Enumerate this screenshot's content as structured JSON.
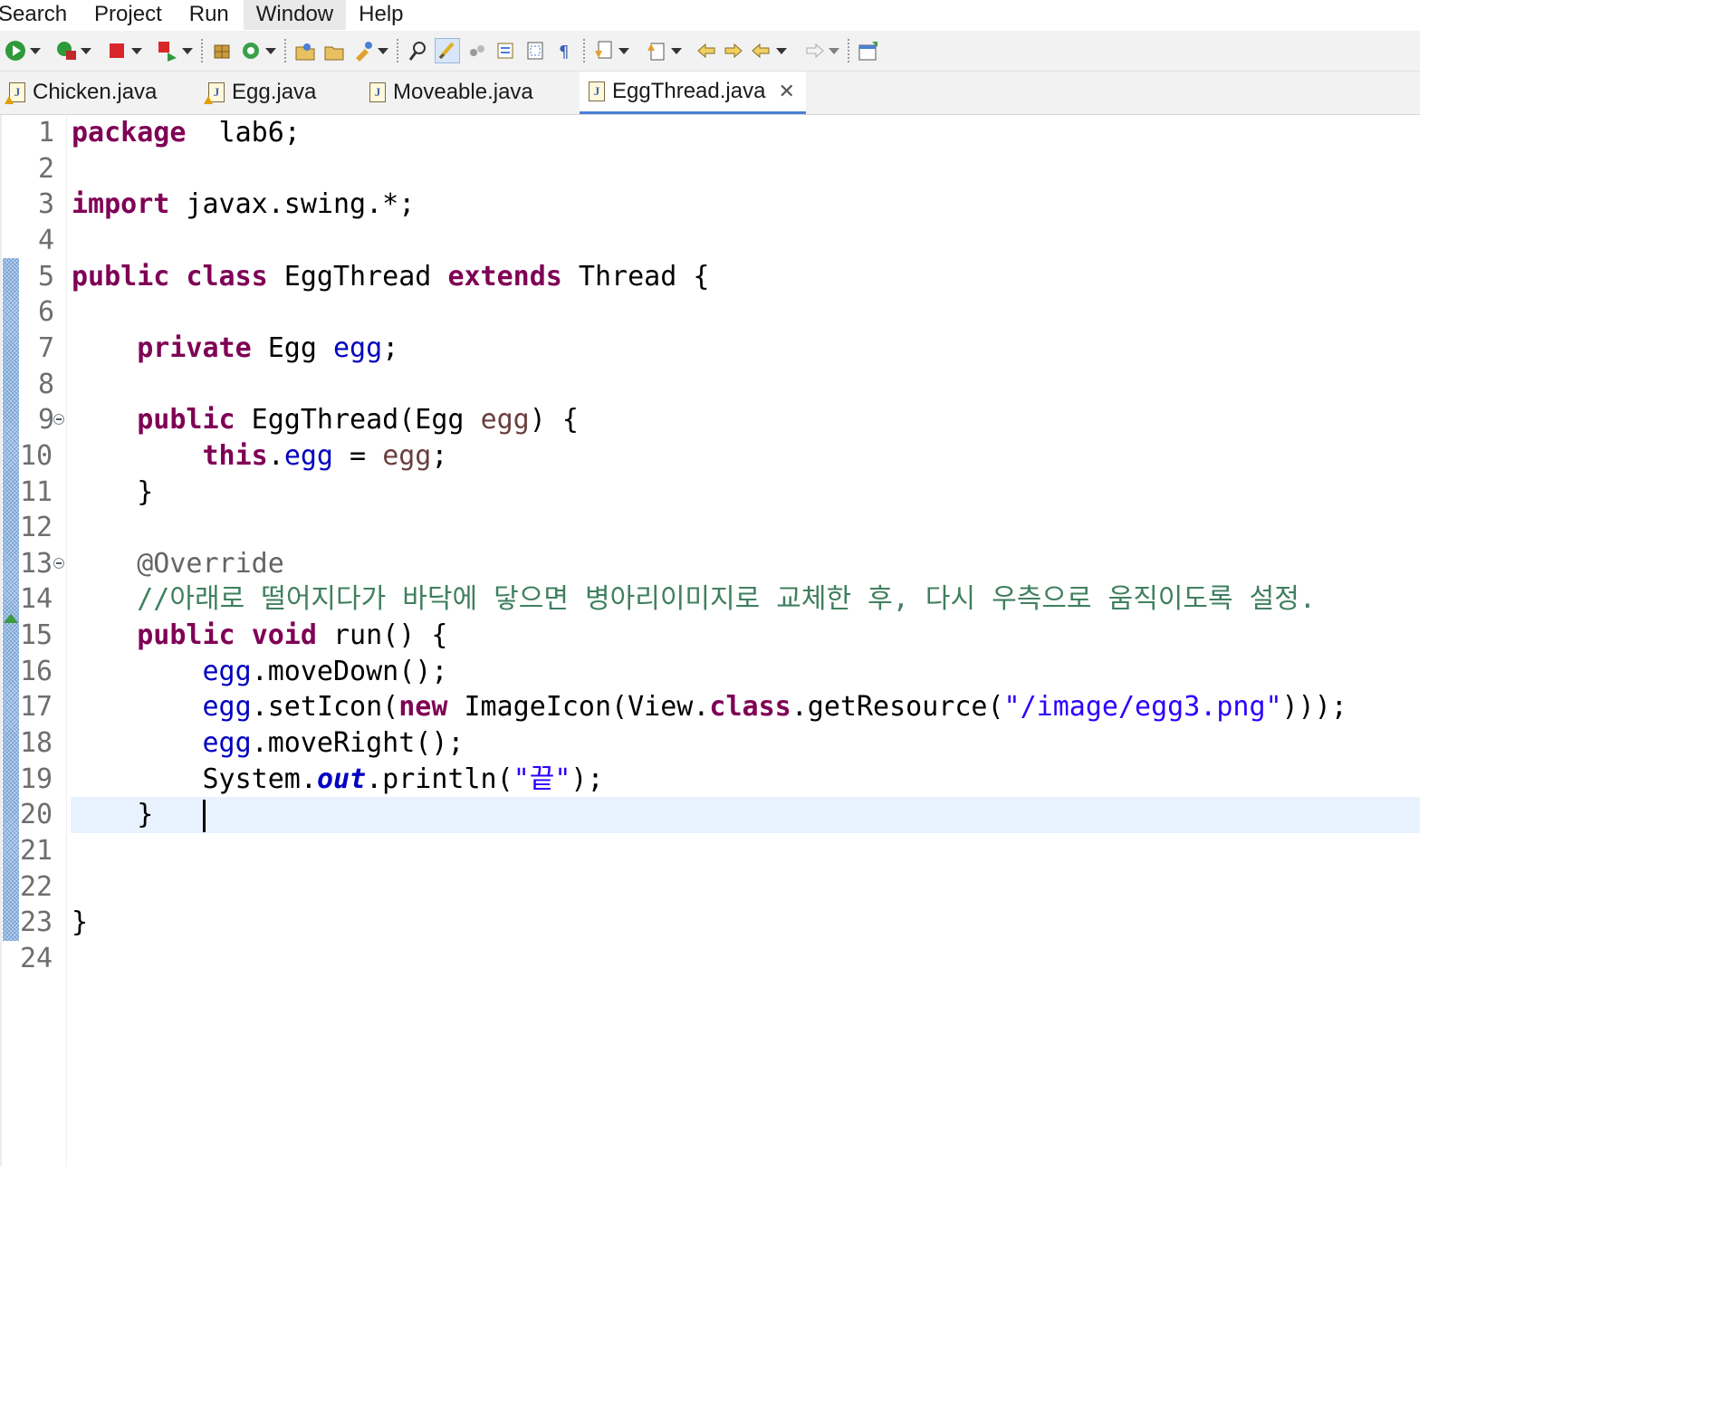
{
  "menu": [
    "Search",
    "Project",
    "Run",
    "Window",
    "Help"
  ],
  "toolbar_icons": [
    "run-icon",
    "debug-icon",
    "terminate-icon",
    "disconnect-icon",
    "new-package-icon",
    "refresh-icon",
    "open-type-icon",
    "open-folder-icon",
    "open-task-icon",
    "search-icon",
    "mark-occurrences-icon",
    "breadcrumb-icon",
    "toggle-comment-icon",
    "block-selection-icon",
    "show-whitespace-icon",
    "next-annotation-icon",
    "previous-annotation-icon",
    "last-edit-icon",
    "forward-history-icon",
    "back-icon",
    "forward-icon",
    "pin-editor-icon"
  ],
  "tabs": [
    {
      "label": "Chicken.java",
      "warning": true,
      "active": false
    },
    {
      "label": "Egg.java",
      "warning": true,
      "active": false
    },
    {
      "label": "Moveable.java",
      "warning": false,
      "active": false
    },
    {
      "label": "EggThread.java",
      "warning": false,
      "active": true,
      "close": "✕"
    }
  ],
  "editor": {
    "current_line": 20,
    "lines": [
      {
        "n": "1",
        "t": [
          [
            "kw",
            "package"
          ],
          [
            "",
            "  lab6;"
          ]
        ]
      },
      {
        "n": "2",
        "t": []
      },
      {
        "n": "3",
        "t": [
          [
            "kw",
            "import"
          ],
          [
            "",
            " javax.swing.*;"
          ]
        ]
      },
      {
        "n": "4",
        "t": []
      },
      {
        "n": "5",
        "t": [
          [
            "kw",
            "public"
          ],
          [
            "",
            " "
          ],
          [
            "kw",
            "class"
          ],
          [
            "",
            " EggThread "
          ],
          [
            "kw",
            "extends"
          ],
          [
            "",
            " Thread {"
          ]
        ]
      },
      {
        "n": "6",
        "t": []
      },
      {
        "n": "7",
        "t": [
          [
            "",
            "    "
          ],
          [
            "kw",
            "private"
          ],
          [
            "",
            " Egg "
          ],
          [
            "fld",
            "egg"
          ],
          [
            "",
            ";"
          ]
        ]
      },
      {
        "n": "8",
        "t": []
      },
      {
        "n": "9",
        "fold": true,
        "t": [
          [
            "",
            "    "
          ],
          [
            "kw",
            "public"
          ],
          [
            "",
            " EggThread(Egg "
          ],
          [
            "par",
            "egg"
          ],
          [
            "",
            ") {"
          ]
        ]
      },
      {
        "n": "10",
        "t": [
          [
            "",
            "        "
          ],
          [
            "kw",
            "this"
          ],
          [
            "",
            "."
          ],
          [
            "fld",
            "egg"
          ],
          [
            "",
            " = "
          ],
          [
            "par",
            "egg"
          ],
          [
            "",
            ";"
          ]
        ]
      },
      {
        "n": "11",
        "t": [
          [
            "",
            "    }"
          ]
        ]
      },
      {
        "n": "12",
        "t": []
      },
      {
        "n": "13",
        "fold": true,
        "t": [
          [
            "",
            "    "
          ],
          [
            "ann",
            "@Override"
          ]
        ]
      },
      {
        "n": "14",
        "t": [
          [
            "",
            "    "
          ],
          [
            "cmt",
            "//아래로 떨어지다가 바닥에 닿으면 병아리이미지로 교체한 후, 다시 우측으로 움직이도록 설정."
          ]
        ]
      },
      {
        "n": "15",
        "override": true,
        "t": [
          [
            "",
            "    "
          ],
          [
            "kw",
            "public"
          ],
          [
            "",
            " "
          ],
          [
            "kw",
            "void"
          ],
          [
            "",
            " run() {"
          ]
        ]
      },
      {
        "n": "16",
        "t": [
          [
            "",
            "        "
          ],
          [
            "fld",
            "egg"
          ],
          [
            "",
            ".moveDown();"
          ]
        ]
      },
      {
        "n": "17",
        "t": [
          [
            "",
            "        "
          ],
          [
            "fld",
            "egg"
          ],
          [
            "",
            ".setIcon("
          ],
          [
            "kw",
            "new"
          ],
          [
            "",
            " ImageIcon(View."
          ],
          [
            "kw",
            "class"
          ],
          [
            "",
            ".getResource("
          ],
          [
            "str",
            "\"/image/egg3.png\""
          ],
          [
            "",
            ")));"
          ]
        ]
      },
      {
        "n": "18",
        "t": [
          [
            "",
            "        "
          ],
          [
            "fld",
            "egg"
          ],
          [
            "",
            ".moveRight();"
          ]
        ]
      },
      {
        "n": "19",
        "t": [
          [
            "",
            "        System."
          ],
          [
            "sfld",
            "out"
          ],
          [
            "",
            ".println("
          ],
          [
            "str",
            "\"끝\""
          ],
          [
            "",
            ");"
          ]
        ]
      },
      {
        "n": "20",
        "caret": true,
        "t": [
          [
            "",
            "    }   "
          ]
        ]
      },
      {
        "n": "21",
        "t": []
      },
      {
        "n": "22",
        "t": []
      },
      {
        "n": "23",
        "t": [
          [
            "",
            "}"
          ]
        ]
      },
      {
        "n": "24",
        "t": []
      }
    ]
  },
  "colors": {
    "keyword": "#7f0055",
    "field": "#0000c0",
    "parameter": "#6a3e3e",
    "string": "#2a00ff",
    "comment": "#3f7f5f",
    "annotation": "#646464",
    "current_line_bg": "#e8f2fe"
  }
}
